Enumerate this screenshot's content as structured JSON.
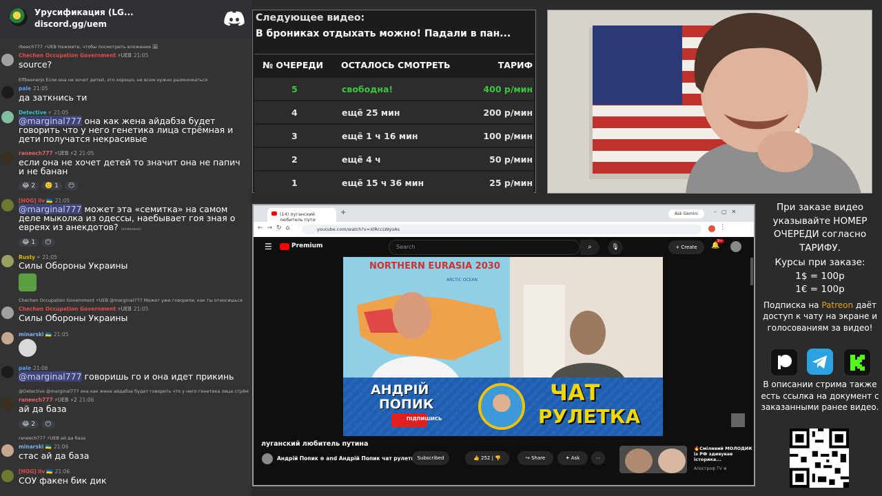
{
  "chat": {
    "server_name": "Урусификация (LG...",
    "server_invite": "discord.gg/uem",
    "messages": [
      {
        "reply": "rbeech777 ⚡UEB  Нажмите, чтобы посмотреть вложение 🖼",
        "author": "Chechen Occupation Government",
        "author_color": "#e24c4c",
        "tag": "⚡UEB",
        "time": "21:05",
        "text": "source?"
      },
      {
        "reply": "Effbeenerjo  Если она не хочет детей, это хорошо, не всем нужно размножаться",
        "author": "pale",
        "author_color": "#5aa0f0",
        "tag": "",
        "time": "21:05",
        "text": "да заткнись ти"
      },
      {
        "author": "Detective",
        "author_color": "#34c0c4",
        "tag": "⚡",
        "time": "21:05",
        "mention": "@marginal777",
        "text": " она как жена айдабза будет говорить что у него генетика лица стрёмная и дети получатся некрасивые"
      },
      {
        "author": "raneech777",
        "author_color": "#e26464",
        "tag": "⚡UEB ⚡2",
        "time": "21:05",
        "text": "если она не хочет детей то значит она не папич и не банан",
        "reactions": [
          "😂 2",
          "🙂 1",
          "😶"
        ]
      },
      {
        "author": "[HOG] liv",
        "author_color": "#e24c4c",
        "tag": "🇺🇦",
        "time": "21:05",
        "mention": "@marginal777",
        "text": " может эта «семитка» на самом деле мыколка из одессы, наебывает гоя зная о евреях из анекдотов?",
        "edited": "(изменено)",
        "reactions": [
          "😂 1",
          "😶"
        ]
      },
      {
        "author": "Rusty",
        "author_color": "#e6b800",
        "tag": "⚡",
        "time": "21:05",
        "text": "Силы Обороны Украины"
      },
      {
        "reply": "Chechen Occupation Government ⚡UEB  @marginal777  Может уже говорили, как ты относишься",
        "author": "Chechen Occupation Government",
        "author_color": "#e24c4c",
        "tag": "⚡UEB",
        "time": "21:05",
        "text": "Силы Обороны Украины"
      },
      {
        "author": "minarski",
        "author_color": "#7fb0f0",
        "tag": "🇺🇦",
        "time": "21:05",
        "text": ""
      },
      {
        "author": "pale",
        "author_color": "#5aa0f0",
        "tag": "",
        "time": "21:06",
        "mention": "@marginal777",
        "text": " говоришь го и она идет прикинь"
      },
      {
        "reply": "@Detective  @marginal777  она как жена айдабза будет говорить что у него генетика лица стрём",
        "author": "raneech777",
        "author_color": "#e26464",
        "tag": "⚡UEB ⚡2",
        "time": "21:06",
        "text": "ай да база",
        "reactions": [
          "😂 2",
          "😶"
        ]
      },
      {
        "reply": "raneech777 ⚡UEB  ай да база",
        "author": "minarski",
        "author_color": "#7fb0f0",
        "tag": "🇺🇦",
        "time": "21:06",
        "text": "стас ай да база"
      },
      {
        "author": "[HOG] liv",
        "author_color": "#e24c4c",
        "tag": "🇺🇦",
        "time": "21:06",
        "text": "СОУ факен бик дик"
      }
    ]
  },
  "queue": {
    "label": "Следующее видео:",
    "title": "В брониках отдыхать можно! Падали в пан...",
    "headers": [
      "№ ОЧЕРЕДИ",
      "ОСТАЛОСЬ СМОТРЕТЬ",
      "ТАРИФ"
    ],
    "rows": [
      {
        "num": "5",
        "left": "свободна!",
        "price": "400 р/мин",
        "highlight": true
      },
      {
        "num": "4",
        "left": "ещё 25 мин",
        "price": "200 р/мин"
      },
      {
        "num": "3",
        "left": "ещё 1 ч 16 мин",
        "price": "100 р/мин"
      },
      {
        "num": "2",
        "left": "ещё 4 ч",
        "price": "50 р/мин"
      },
      {
        "num": "1",
        "left": "ещё 15 ч 36 мин",
        "price": "25 р/мин"
      }
    ],
    "highlight_color": "#3cc83c"
  },
  "browser": {
    "tab_title": "(14) луганский любитель пути",
    "gemini": "Ask Gemini",
    "url": "youtube.com/watch?v=XlRccLWyoAs",
    "yt_logo": "Premium",
    "search_placeholder": "Search",
    "create": "Create",
    "notif_badge": "9+",
    "video_map_title": "NORTHERN EURASIA 2030",
    "video_map_ocean": "ARCTIC OCEAN",
    "banner_name_1": "АНДРІЙ",
    "banner_name_2": "ПОПИК",
    "banner_subscribe": "ПІДПИШИСЬ",
    "banner_right_1": "ЧАТ",
    "banner_right_2": "РУЛЕТКА",
    "video_title": "луганский любитель путина",
    "channel": "Андрій Попик ⊕ and Андрій Попик чат рулетка",
    "subscribed": "Subscribed",
    "likes": "252",
    "share": "Share",
    "ask": "Ask",
    "reco_title": "🔥Сміливий МОЛОДИК із РФ здивував історика...",
    "reco_channel": "Апостроф TV ⊕"
  },
  "info": {
    "p1": "При заказе видео указывайте НОМЕР ОЧЕРЕДИ согласно ТАРИФУ.",
    "p2_title": "Курсы при заказе:",
    "rate_usd": "1$ = 100р",
    "rate_eur": "1€ = 100р",
    "sub_pre": "Подписка на ",
    "sub_patreon": "Patreon",
    "sub_post": " даёт доступ к чату на экране и голосованиям за видео!",
    "desc": "В описании стрима также есть ссылка на документ с заказанными ранее видео."
  },
  "colors": {
    "discord": "#ffffff",
    "patreon_accent": "#e0a21c",
    "telegram": "#2aa3e0",
    "kick": "#53fc18"
  }
}
